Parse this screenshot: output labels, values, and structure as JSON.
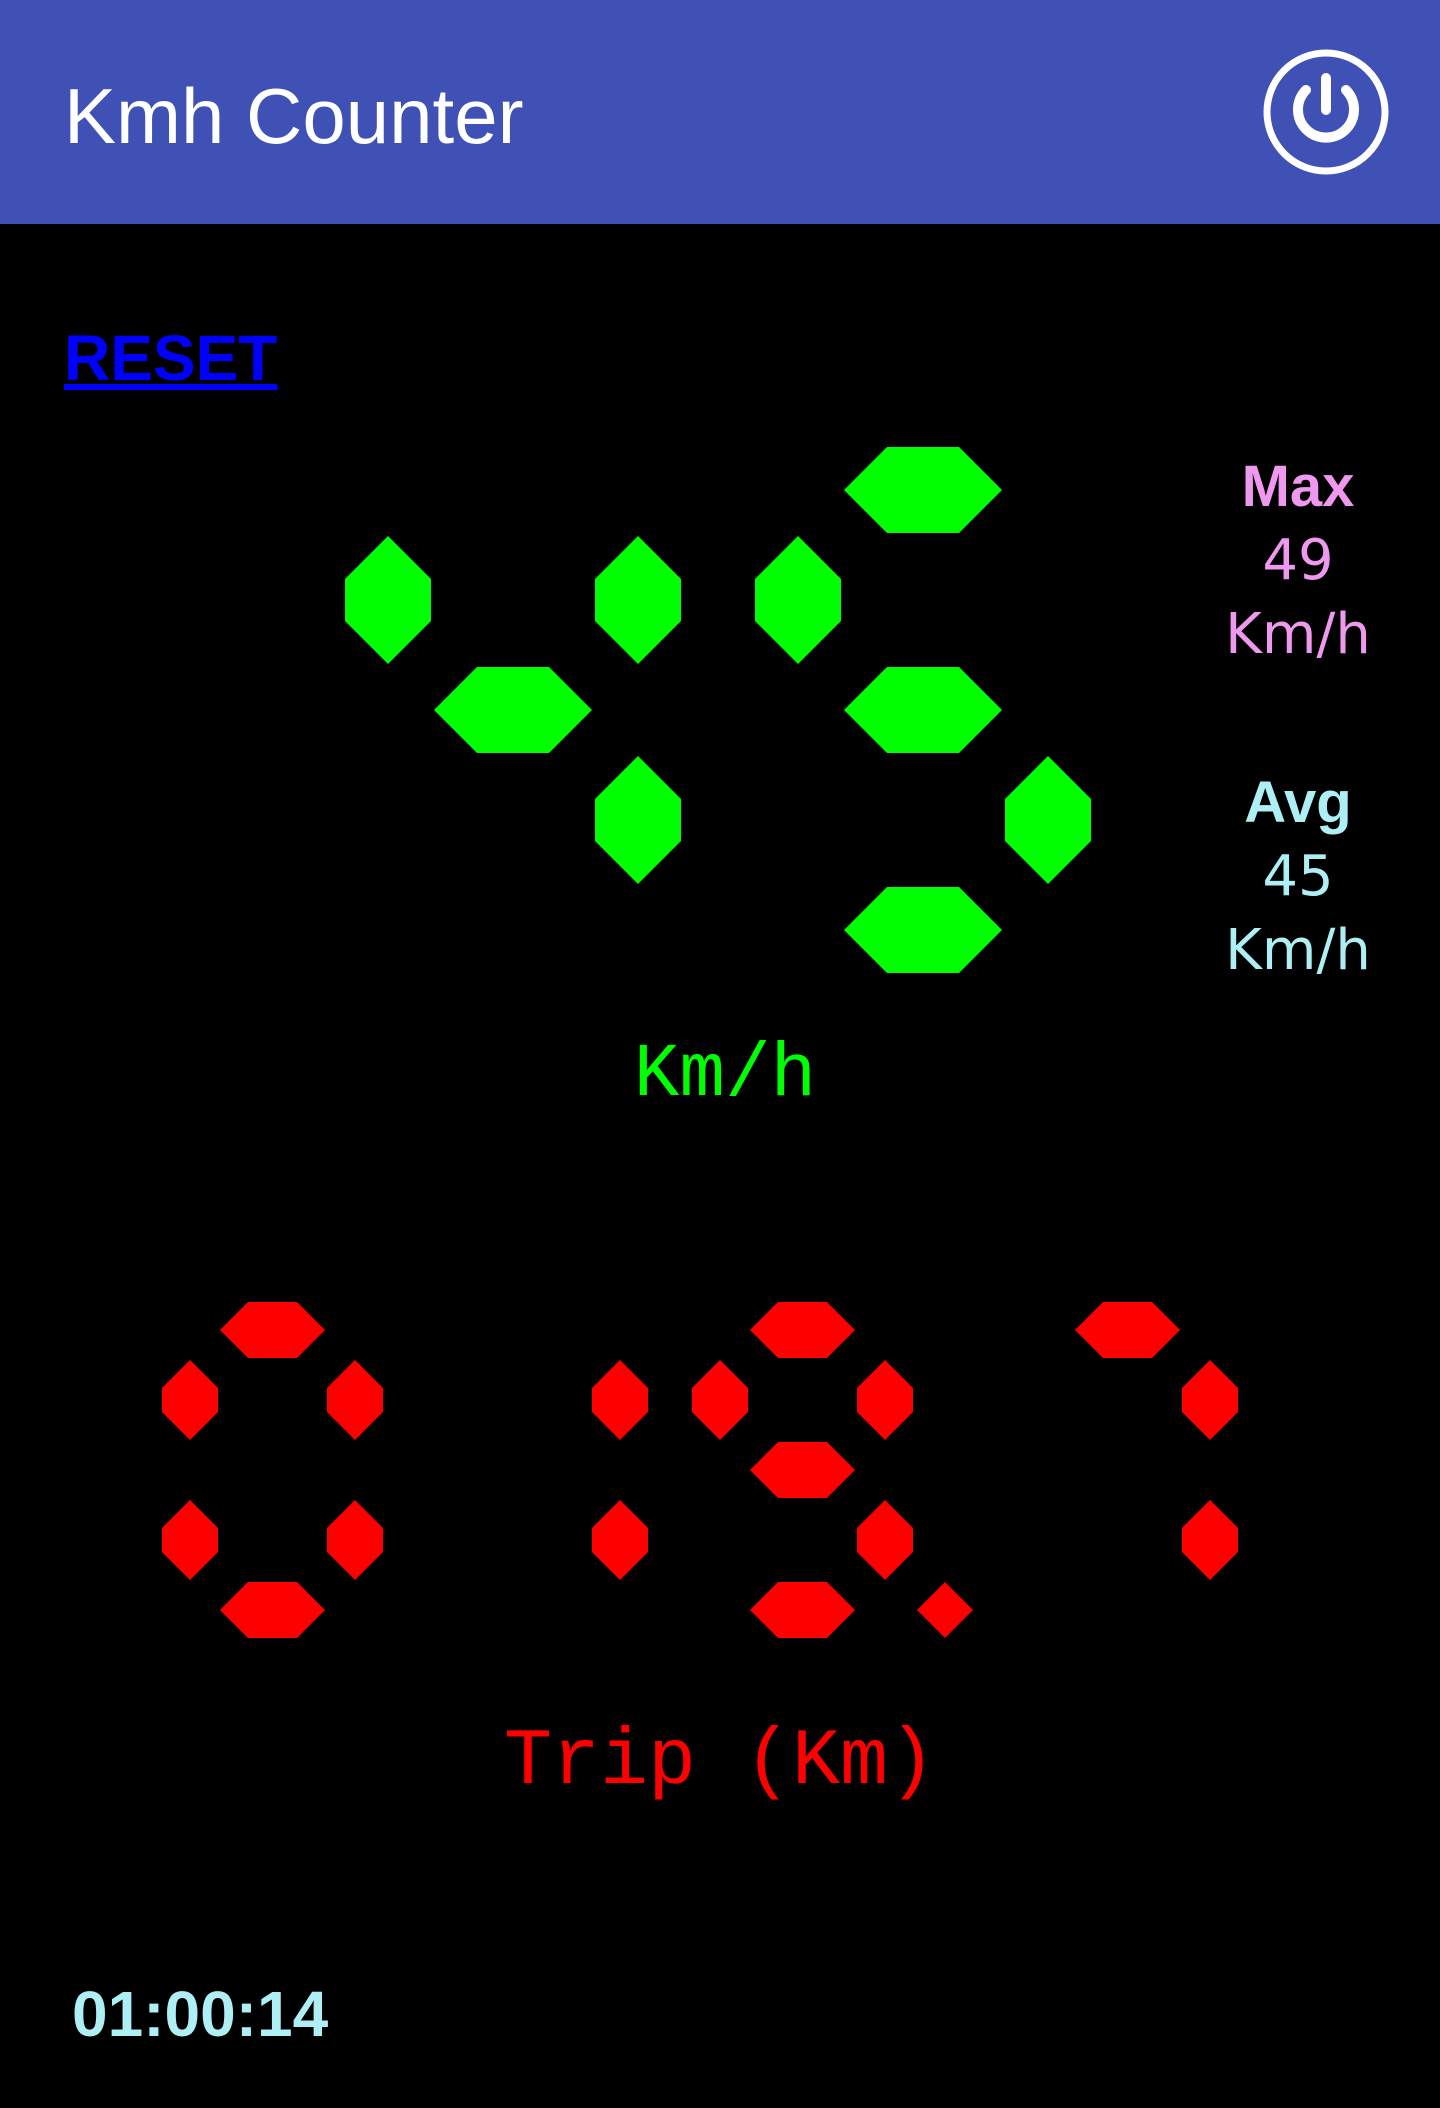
{
  "app_bar": {
    "title": "Kmh Counter",
    "power_icon": "power-icon",
    "background_color": "#3F51B5"
  },
  "reset": {
    "label": "RESET",
    "color": "#0000FF"
  },
  "speed": {
    "value": "45",
    "unit": "Km/h",
    "color": "#00FF00"
  },
  "max": {
    "label": "Max",
    "value": "49",
    "unit": "Km/h",
    "color": "#EE99EE"
  },
  "avg": {
    "label": "Avg",
    "value": "45",
    "unit": "Km/h",
    "color": "#AEEEF5"
  },
  "trip": {
    "value": "019.7",
    "label": "Trip (Km)",
    "color": "#FF0000"
  },
  "elapsed": {
    "value": "01:00:14",
    "color": "#AEEEF5"
  }
}
